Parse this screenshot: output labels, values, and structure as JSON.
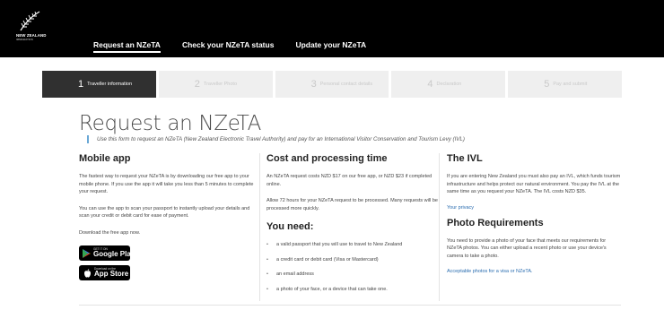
{
  "header": {
    "logo_text": "NEW ZEALAND",
    "logo_subtext": "IMMIGRATION",
    "nav": [
      {
        "label": "Request an NZeTA"
      },
      {
        "label": "Check your NZeTA status"
      },
      {
        "label": "Update your NZeTA"
      }
    ]
  },
  "steps": [
    {
      "num": "1",
      "label": "Traveller information"
    },
    {
      "num": "2",
      "label": "Traveller Photo"
    },
    {
      "num": "3",
      "label": "Personal contact details"
    },
    {
      "num": "4",
      "label": "Declaration"
    },
    {
      "num": "5",
      "label": "Pay and submit"
    }
  ],
  "page": {
    "title": "Request an NZeTA",
    "subtitle": "Use this form to request an NZeTA (New Zealand Electronic Travel Authority) and pay for an International Visitor Conservation and Tourism Levy (IVL)"
  },
  "mobile_app": {
    "heading": "Mobile app",
    "p1": "The fastest way to request your NZeTA is by downloading our free app to your mobile phone. If you use the app it will take you less than 5 minutes to complete your request.",
    "p2": "You can use the app to scan your passport to instantly upload your details and scan your credit or debit card for ease of payment.",
    "p3": "Download the free app now.",
    "google_small": "GET IT ON",
    "google_big": "Google Play",
    "apple_small": "Download on the",
    "apple_big": "App Store"
  },
  "cost": {
    "heading": "Cost and processing time",
    "p1": "An NZeTA request costs NZD $17 on our free app, or NZD $23 if completed online.",
    "p2": "Allow 72 hours for your NZeTA request to be processed. Many requests will be processed more quickly."
  },
  "need": {
    "heading": "You need:",
    "bullet": "•",
    "items": [
      "a valid passport that you will use to travel to New Zealand",
      "a credit card or debit card (Visa or Mastercard)",
      "an email address",
      "a photo of your face, or a device that can take one."
    ]
  },
  "ivl": {
    "heading": "The IVL",
    "p1": "If you are entering New Zealand you must also pay an IVL, which funds tourism infrastructure and helps protect our natural environment. You pay the IVL at the same time as you request your NZeTA. The IVL costs NZD $35.",
    "link": "Your privacy"
  },
  "photo": {
    "heading": "Photo Requirements",
    "p1": "You need to provide a photo of your face that meets our requirements for NZeTA photos. You can either upload a recent photo or use your device's camera to take a photo.",
    "link": "Acceptable photos for a visa or NZeTA."
  },
  "colors": {
    "header_bg": "#000000",
    "step_active": "#303030",
    "step_inactive": "#efefef",
    "link": "#2a6db0",
    "subtitle_bar": "#6aa8d6"
  }
}
